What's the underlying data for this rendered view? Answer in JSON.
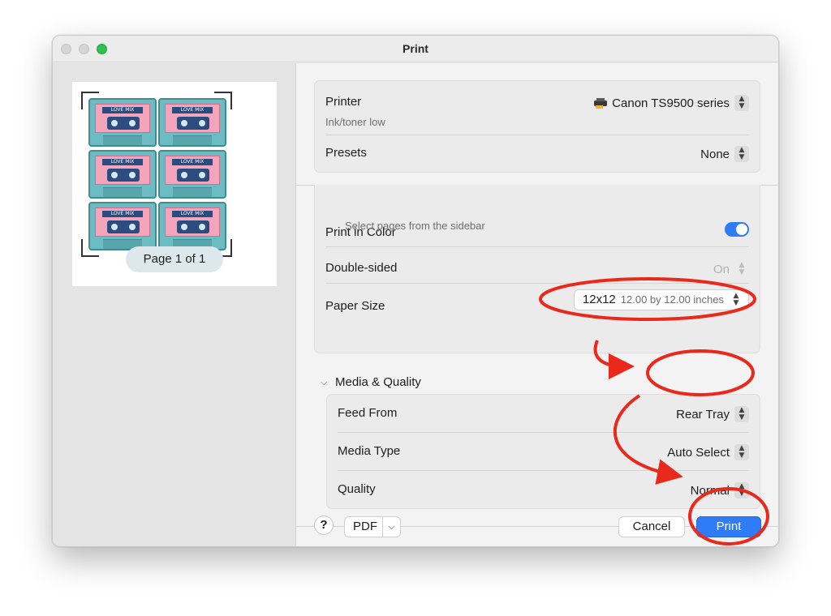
{
  "window": {
    "title": "Print"
  },
  "preview": {
    "page_indicator": "Page 1 of 1",
    "tape_label": "LOVE MIX"
  },
  "printer": {
    "label": "Printer",
    "value": "Canon TS9500 series",
    "status": "Ink/toner low",
    "icon": "printer-icon"
  },
  "presets": {
    "label": "Presets",
    "value": "None"
  },
  "pages_hint": "Select pages from the sidebar",
  "print_in_color": {
    "label": "Print in Color",
    "enabled": true
  },
  "double_sided": {
    "label": "Double-sided",
    "value": "On"
  },
  "paper_size": {
    "label": "Paper Size",
    "value": "12x12",
    "detail": "12.00 by 12.00 inches"
  },
  "media_quality": {
    "section_label": "Media & Quality",
    "feed_from": {
      "label": "Feed From",
      "value": "Rear Tray"
    },
    "media_type": {
      "label": "Media Type",
      "value": "Auto Select"
    },
    "quality": {
      "label": "Quality",
      "value": "Normal"
    }
  },
  "footer": {
    "help": "?",
    "pdf": "PDF",
    "cancel": "Cancel",
    "print": "Print"
  },
  "colors": {
    "accent": "#2f7cf6",
    "annotation": "#e8291c",
    "traffic_green": "#2ec14b"
  }
}
